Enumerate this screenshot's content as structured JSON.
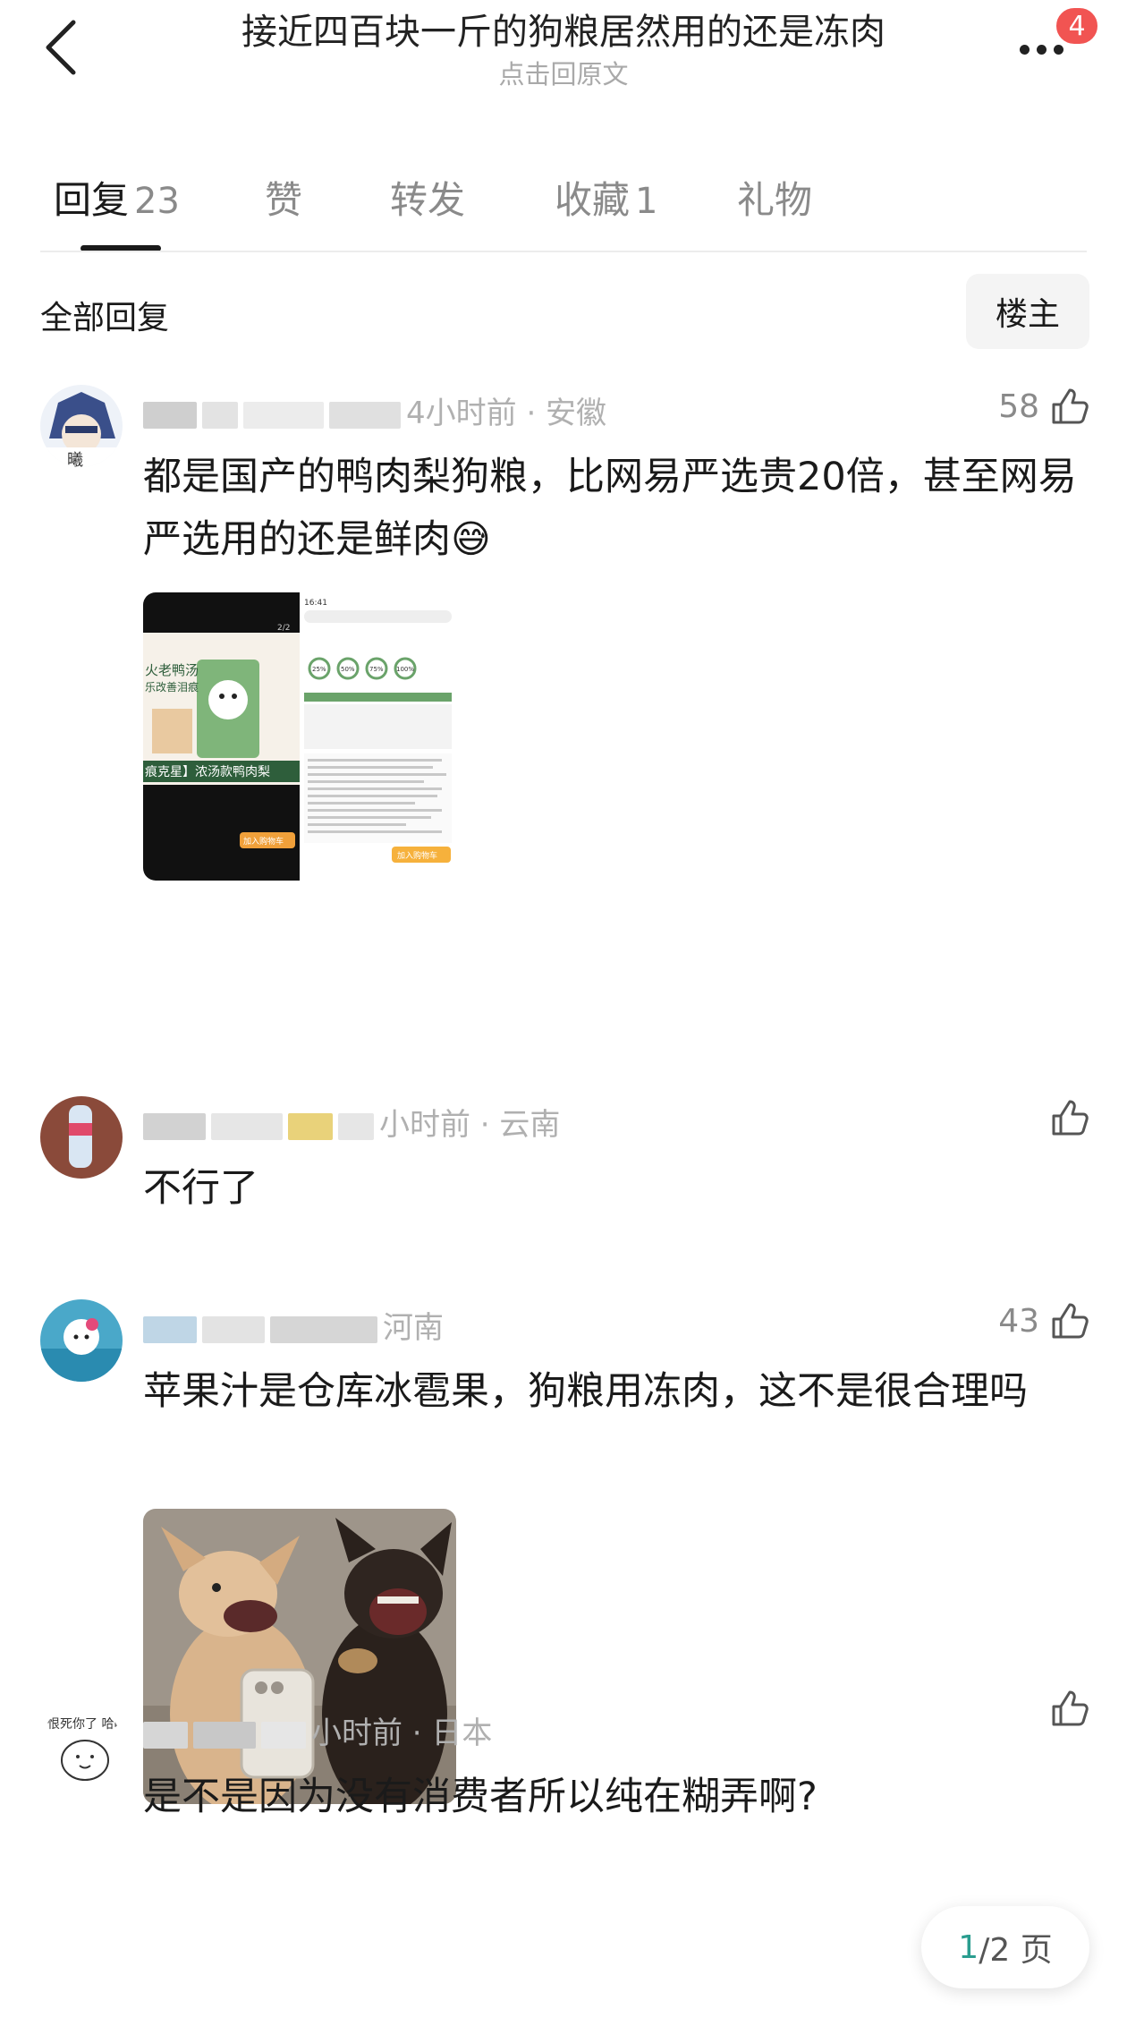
{
  "header": {
    "title": "接近四百块一斤的狗粮居然用的还是冻肉",
    "subtitle": "点击回原文",
    "notification_count": "4"
  },
  "tabs": [
    {
      "label": "回复",
      "count": "23"
    },
    {
      "label": "赞",
      "count": ""
    },
    {
      "label": "转发",
      "count": ""
    },
    {
      "label": "收藏",
      "count": "1"
    },
    {
      "label": "礼物",
      "count": ""
    }
  ],
  "filter": {
    "all_label": "全部回复",
    "op_label": "楼主"
  },
  "comments": [
    {
      "meta": "4小时前 · 安徽",
      "likes": "58",
      "text": "都是国产的鸭肉梨狗粮，比网易严选贵20倍，甚至网易严选用的还是鲜肉😅",
      "image_texts": {
        "left_product": "火老鸭汤",
        "left_sub": "乐改善泪痕",
        "left_banner": "痕克星】浓汤款鸭肉梨",
        "left_page": "2/2",
        "left_cart": "加入购物车",
        "right_time": "16:41",
        "right_pcts": [
          "25%",
          "50%",
          "75%",
          "100%"
        ],
        "right_cart": "加入购物车"
      }
    },
    {
      "meta": "小时前 · 云南",
      "likes": "",
      "text": "不行了"
    },
    {
      "meta": "河南",
      "likes": "43",
      "text": "苹果汁是仓库冰雹果，狗粮用冻肉，这不是很合理吗"
    },
    {
      "meta": "小时前 · 日本",
      "likes": "",
      "text": "是不是因为没有消费者所以纯在糊弄啊?",
      "avatar_text": "恨死你了 哈哈"
    }
  ],
  "pager": {
    "current": "1",
    "total": "/2 页"
  },
  "colors": {
    "badge": "#f15452",
    "pager_current": "#2a9d8f",
    "muted": "#b0b0b0"
  }
}
